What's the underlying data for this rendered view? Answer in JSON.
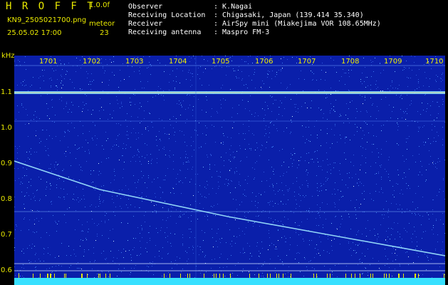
{
  "header": {
    "title": "H R O F F T",
    "version": "1.0.0f",
    "filename": "KN9_2505021700.png",
    "timestamp": "25.05.02 17:00",
    "meteor_label": "meteor",
    "meteor_count": "23"
  },
  "meta": {
    "observer_label": "Observer",
    "observer_value": ": K.Nagai",
    "location_label": "Receiving Location",
    "location_value": ": Chigasaki, Japan (139.414 35.340)",
    "receiver_label": "Receiver",
    "receiver_value": ": AirSpy mini (Miakejima VOR 108.65MHz)",
    "antenna_label": "Receiving antenna",
    "antenna_value": ": Maspro FM-3"
  },
  "axis": {
    "unit": "kHz",
    "y_ticks": [
      "1.1",
      "1.0",
      "0.9",
      "0.8",
      "0.7",
      "0.6"
    ],
    "x_ticks": [
      "1701",
      "1702",
      "1703",
      "1704",
      "1705",
      "1706",
      "1707",
      "1708",
      "1709",
      "1710"
    ]
  },
  "colors": {
    "background": "#0a1faa",
    "label": "#e8e800",
    "trace": "#9fe8ff",
    "band": "#38e0ff"
  }
}
